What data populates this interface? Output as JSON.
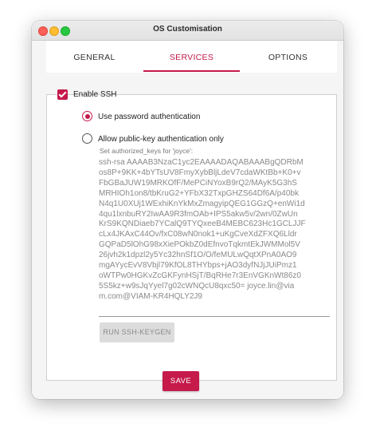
{
  "window": {
    "title": "OS Customisation"
  },
  "tabs": [
    {
      "label": "GENERAL",
      "active": false
    },
    {
      "label": "SERVICES",
      "active": true
    },
    {
      "label": "OPTIONS",
      "active": false
    }
  ],
  "ssh": {
    "enable_label": "Enable SSH",
    "enabled": true,
    "password_auth_label": "Use password authentication",
    "pubkey_auth_label": "Allow public-key authentication only",
    "selected_mode": "password",
    "keys_label": "Set authorized_keys for 'joyce':",
    "keys_lines": [
      "ssh-rsa AAAAB3NzaC1yc2EAAAADAQABAAABgQDRbM",
      "os8P+9KK+4bYTsUV8FmyXybBljLdeV7cdaWKtBb+K0+v",
      "FbGBaJUW19MRKOfF/MePCiNYoxB9rQ2/MAyK5G3hS",
      "MRHIOh1on8/tbKruG2+YFbX32TxpGHZS64Df6A/p40bk",
      "N4q1U0XUj1WExhiKnYkMxZmagyipQEG1GGzQ+enWi1d",
      "4qu1lxnbuRY2IwAA9R3fmOAb+IPS5akw5v/2wn/0ZwUn",
      "KrS9KQNDiaeb7YCalQ9TYQxeeB4MEBC623Hc1GCLJJF",
      "cLx4JKAxC44Ov/fxC08wN0nok1+uKgCveXdZFXQ6Lldr",
      "GQPaD5lOhG98xXiePOkbZ0dEfnvoTqkmtEkJWMMol5V",
      "26jvh2k1dpzl2y5Yc32hnSf1O/O/feMULwQqtXPnA0AO9",
      "mgAYycEvV8Vbjl79KfOL8THYbps+jAO3dyfNJjJUiPmz1",
      "oWTPw0HGKvZcGKFynHSjT/BqRHe7r3EnVGKnWt86z0",
      "5S5kz+w9sJqYyel7g02cWNQcU8qxc50= joyce.lin@via",
      "m.com@VIAM-KR4HQLY2J9"
    ],
    "keygen_label": "RUN SSH-KEYGEN"
  },
  "footer": {
    "save_label": "SAVE"
  },
  "colors": {
    "accent": "#c51a4a",
    "tab_inactive_text": "#333333",
    "disabled_text": "#8a8a8a",
    "disabled_button_bg": "#dcdcdc"
  }
}
